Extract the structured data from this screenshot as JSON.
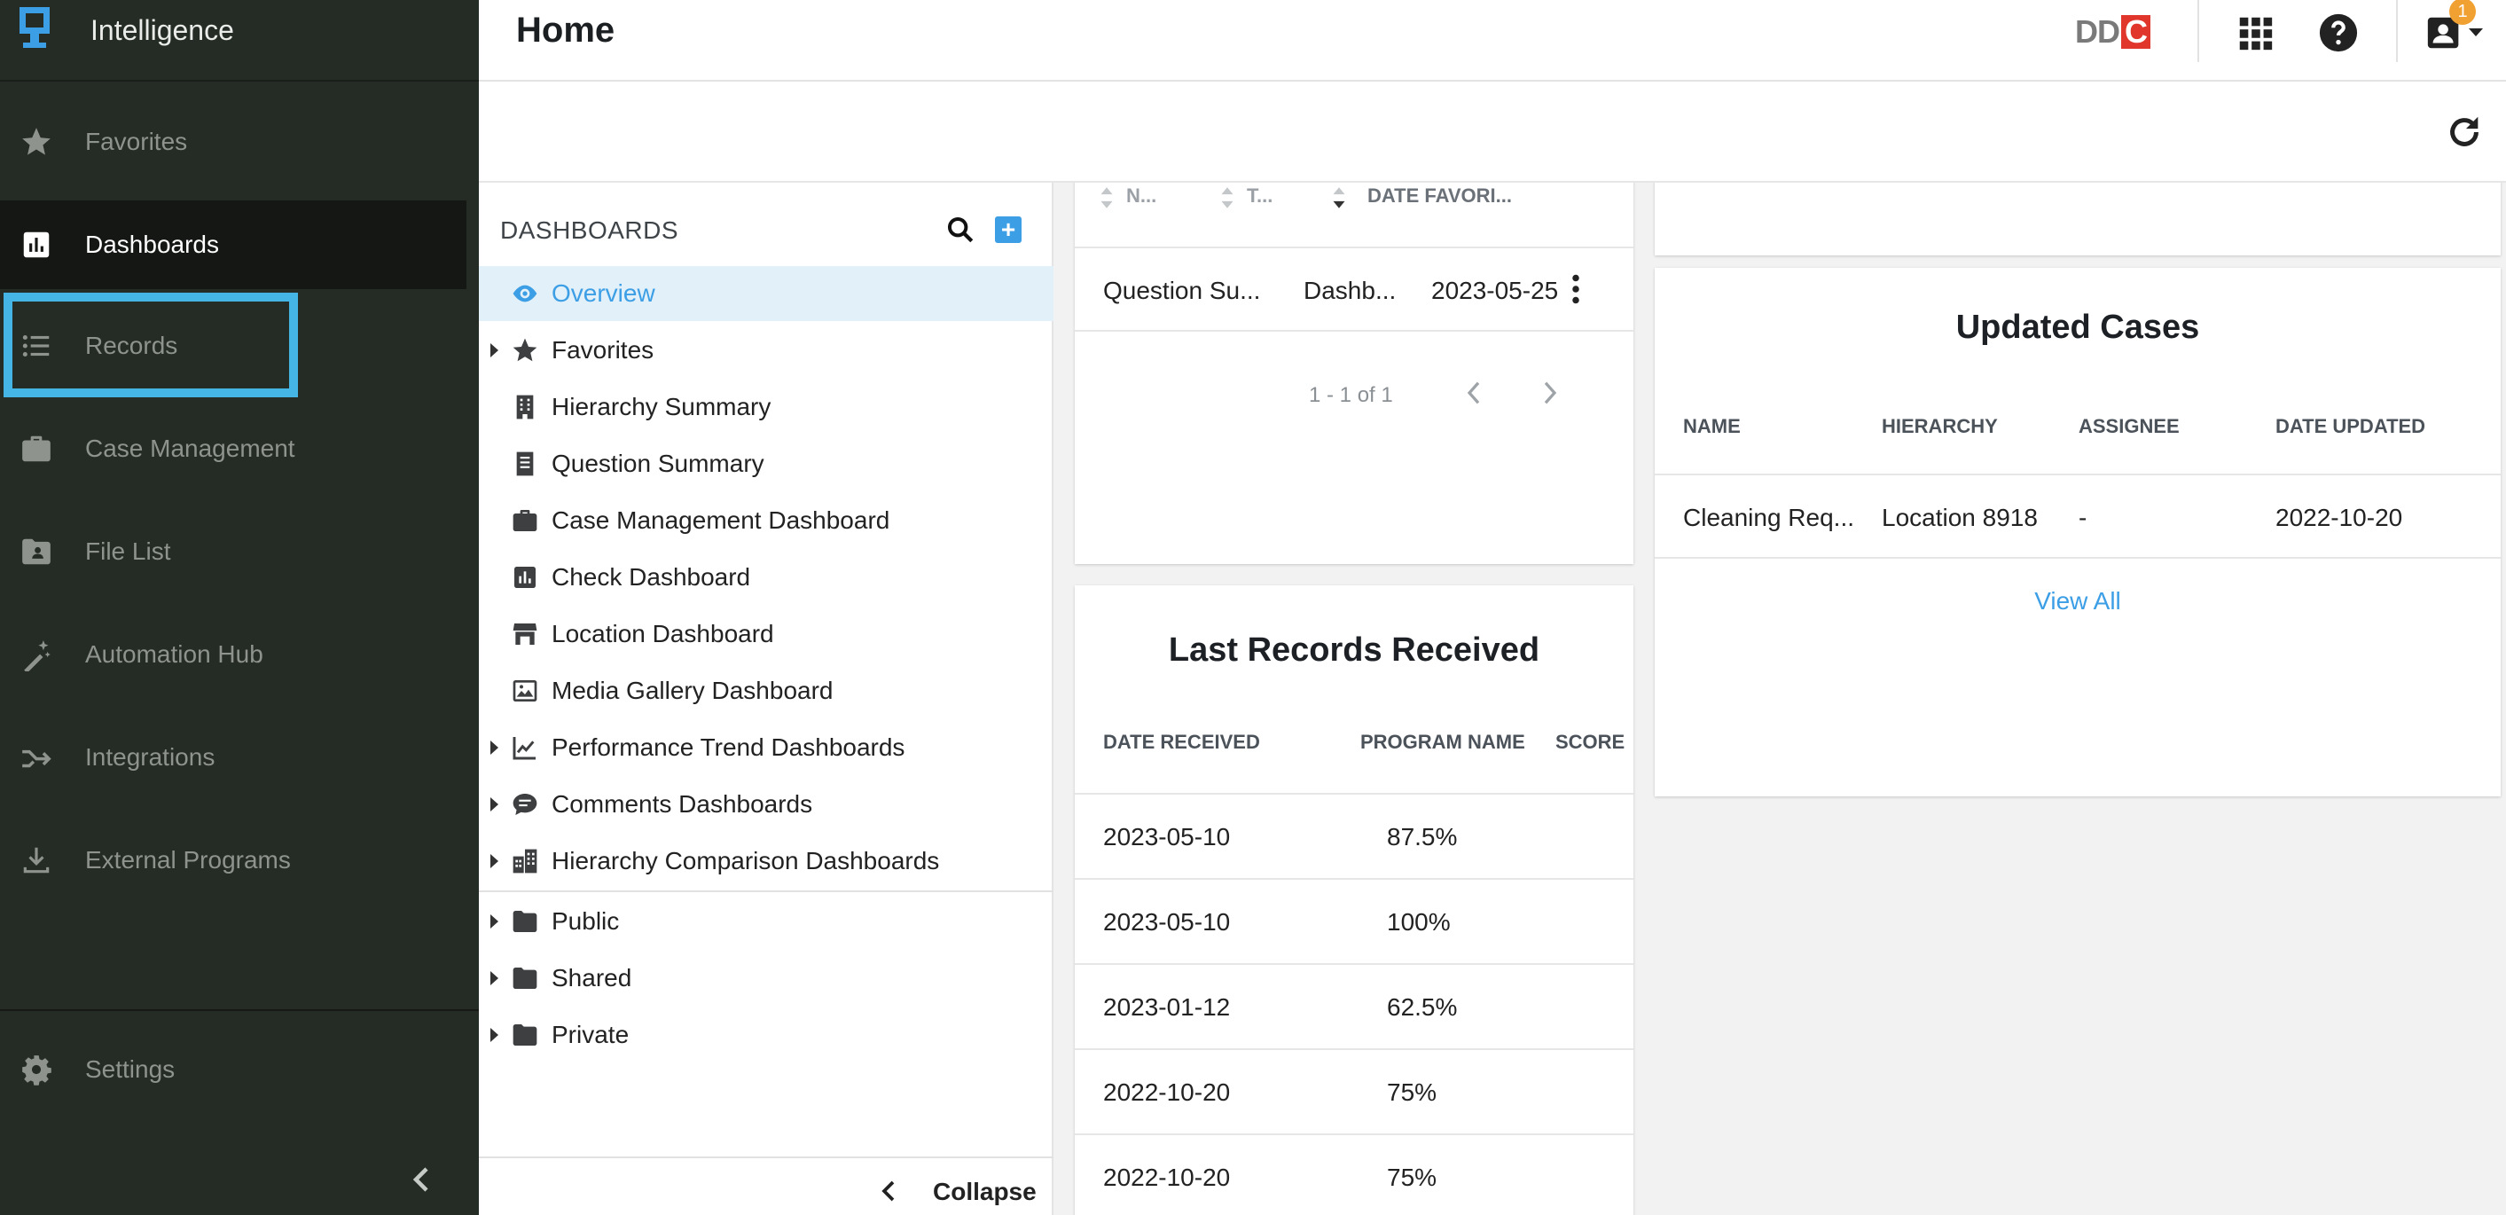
{
  "brand": {
    "name": "Intelligence"
  },
  "nav": {
    "items": [
      {
        "label": "Favorites",
        "icon": "star-icon"
      },
      {
        "label": "Dashboards",
        "icon": "bar-chart-icon"
      },
      {
        "label": "Records",
        "icon": "list-icon"
      },
      {
        "label": "Case Management",
        "icon": "briefcase-icon"
      },
      {
        "label": "File List",
        "icon": "folder-user-icon"
      },
      {
        "label": "Automation Hub",
        "icon": "magic-wand-icon"
      },
      {
        "label": "Integrations",
        "icon": "merge-arrow-icon"
      },
      {
        "label": "External Programs",
        "icon": "download-icon"
      }
    ],
    "active": "Dashboards",
    "highlighted": "Records",
    "settings_label": "Settings"
  },
  "header": {
    "title": "Home",
    "logo_text_dd": "DD",
    "logo_text_c": "C",
    "notification_count": "1"
  },
  "dashboards_panel": {
    "heading": "DASHBOARDS",
    "items": [
      {
        "label": "Overview",
        "icon": "eye-icon",
        "selected": true
      },
      {
        "label": "Favorites",
        "icon": "star-icon",
        "expandable": true
      },
      {
        "label": "Hierarchy Summary",
        "icon": "building-icon"
      },
      {
        "label": "Question Summary",
        "icon": "document-icon"
      },
      {
        "label": "Case Management Dashboard",
        "icon": "briefcase-icon"
      },
      {
        "label": "Check Dashboard",
        "icon": "bar-chart-icon"
      },
      {
        "label": "Location Dashboard",
        "icon": "store-icon"
      },
      {
        "label": "Media Gallery Dashboard",
        "icon": "image-icon"
      },
      {
        "label": "Performance Trend Dashboards",
        "icon": "trend-icon",
        "expandable": true
      },
      {
        "label": "Comments Dashboards",
        "icon": "comment-icon",
        "expandable": true
      },
      {
        "label": "Hierarchy Comparison Dashboards",
        "icon": "buildings-icon",
        "expandable": true
      }
    ],
    "folders": [
      {
        "label": "Public",
        "icon": "folder-icon"
      },
      {
        "label": "Shared",
        "icon": "folder-icon"
      },
      {
        "label": "Private",
        "icon": "folder-icon"
      }
    ],
    "collapse_label": "Collapse"
  },
  "favorites_card": {
    "columns": [
      "N...",
      "T...",
      "DATE FAVORI..."
    ],
    "row": {
      "name": "Question Su...",
      "type": "Dashb...",
      "date": "2023-05-25"
    },
    "pager": "1 - 1 of 1"
  },
  "last_records": {
    "title": "Last Records Received",
    "columns": [
      "DATE RECEIVED",
      "PROGRAM NAME",
      "SCORE"
    ],
    "rows": [
      {
        "date": "2023-05-10",
        "score": "87.5%"
      },
      {
        "date": "2023-05-10",
        "score": "100%"
      },
      {
        "date": "2023-01-12",
        "score": "62.5%"
      },
      {
        "date": "2022-10-20",
        "score": "75%"
      },
      {
        "date": "2022-10-20",
        "score": "75%"
      }
    ]
  },
  "updated_cases": {
    "title": "Updated Cases",
    "columns": [
      "NAME",
      "HIERARCHY",
      "ASSIGNEE",
      "DATE UPDATED"
    ],
    "row": {
      "name": "Cleaning Req...",
      "hierarchy": "Location 8918",
      "assignee": "-",
      "date": "2022-10-20"
    },
    "view_all": "View All"
  },
  "colors": {
    "nav_bg": "#252b25",
    "accent": "#3c9ee5",
    "highlight_outline": "#44b5e5",
    "badge": "#f1a131",
    "logo_red": "#e0362c"
  }
}
